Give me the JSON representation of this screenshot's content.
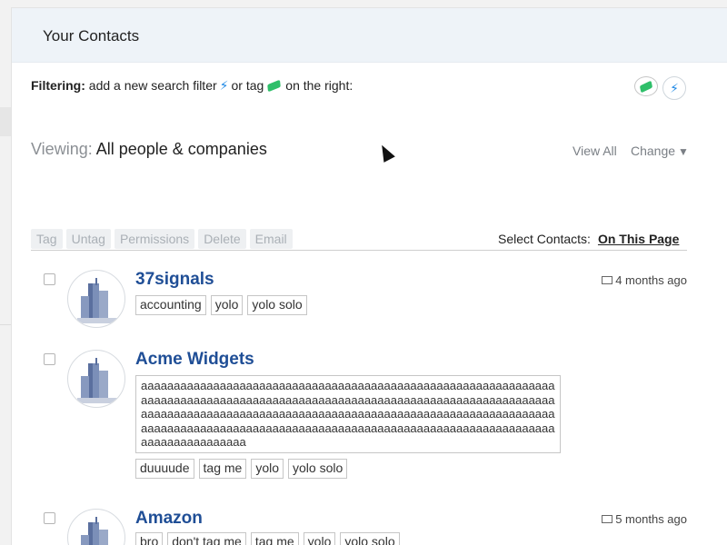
{
  "header": {
    "title": "Your Contacts"
  },
  "filter": {
    "label": "Filtering:",
    "text_1": "add a new search filter",
    "text_2": "or tag",
    "text_3": "on the right:"
  },
  "viewing": {
    "label": "Viewing:",
    "value": "All people & companies",
    "view_all": "View All",
    "change": "Change"
  },
  "toolbar": {
    "buttons": [
      "Tag",
      "Untag",
      "Permissions",
      "Delete",
      "Email"
    ]
  },
  "select": {
    "label": "Select Contacts:",
    "link": "On This Page"
  },
  "contacts": [
    {
      "name": "37signals",
      "date": "4 months ago",
      "tags": [
        "accounting",
        "yolo",
        "yolo solo"
      ]
    },
    {
      "name": "Acme Widgets",
      "note": "aaaaaaaaaaaaaaaaaaaaaaaaaaaaaaaaaaaaaaaaaaaaaaaaaaaaaaaaaaaaaaaaaaaaaaaaaaaaaaaaaaaaaaaaaaaaaaaaaaaaaaaaaaaaaaaaaaaaaaaaaaaaaaaaaaaaaaaaaaaaaaaaaaaaaaaaaaaaaaaaaaaaaaaaaaaaaaaaaaaaaaaaaaaaaaaaaaaaaaaaaaaaaaaaaaaaaaaaaaaaaaaaaaaaaaaaaaaaaaaaaaaaaaaaaaaaaaaaaaaaaaaaaaaa",
      "tags": [
        "duuuude",
        "tag me",
        "yolo",
        "yolo solo"
      ]
    },
    {
      "name": "Amazon",
      "date": "5 months ago",
      "tags": [
        "bro",
        "don't tag me",
        "tag me",
        "yolo",
        "yolo solo"
      ]
    }
  ],
  "icons": {
    "filter": "bolt-icon",
    "tag": "tag-icon",
    "mail": "mail-icon",
    "avatar": "building-icon"
  },
  "colors": {
    "link": "#1f4e96",
    "bolt": "#1e88e5",
    "tag": "#2fbf6a",
    "header_bg": "#eef3f8"
  }
}
